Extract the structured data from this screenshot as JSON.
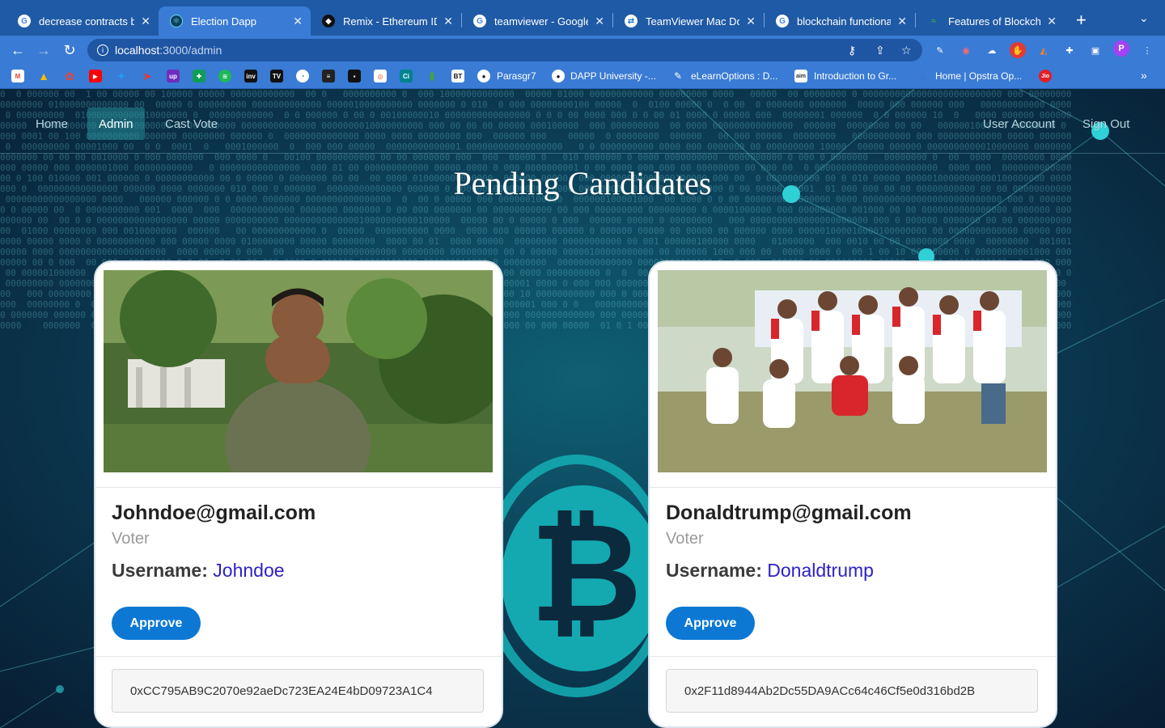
{
  "browser": {
    "tabs": [
      {
        "title": "decrease contracts b",
        "icon": "google-icon"
      },
      {
        "title": "Election Dapp",
        "icon": "react-icon",
        "active": true
      },
      {
        "title": "Remix - Ethereum IDE",
        "icon": "remix-icon"
      },
      {
        "title": "teamviewer - Google",
        "icon": "google-icon"
      },
      {
        "title": "TeamViewer Mac Dow",
        "icon": "teamviewer-icon"
      },
      {
        "title": "blockchain functional",
        "icon": "google-icon"
      },
      {
        "title": "Features of Blockchai",
        "icon": "site-icon"
      }
    ],
    "url_host": "localhost",
    "url_path": ":3000/admin",
    "profile_initial": "P",
    "bookmarks": [
      {
        "label": "Parasgr7",
        "icon": "github-icon"
      },
      {
        "label": "DAPP University -...",
        "icon": "github-icon"
      },
      {
        "label": "eLearnOptions : D...",
        "icon": "elearn-icon"
      },
      {
        "label": "Introduction to Gr...",
        "icon": "aim-icon"
      },
      {
        "label": "Home | Opstra Op...",
        "icon": "opstra-icon"
      }
    ],
    "bookmark_icon_labels": [
      "inv",
      "TV",
      "BT",
      "Ci",
      "up"
    ]
  },
  "nav": {
    "home": "Home",
    "admin": "Admin",
    "cast_vote": "Cast Vote",
    "user_account": "User Account",
    "sign_out": "Sign Out"
  },
  "page_title": "Pending Candidates",
  "labels": {
    "username_prefix": "Username: ",
    "approve": "Approve"
  },
  "candidates": [
    {
      "email": "Johndoe@gmail.com",
      "role": "Voter",
      "username": "Johndoe",
      "address": "0xCC795AB9C2070e92aeDc723EA24E4bD09723A1C4"
    },
    {
      "email": "Donaldtrump@gmail.com",
      "role": "Voter",
      "username": "Donaldtrump",
      "address": "0x2F11d8944Ab2Dc55DA9ACc64c46Cf5e0d316bd2B"
    }
  ],
  "colors": {
    "accent_button": "#0c78d4",
    "username_value": "#2b1fc9",
    "browser_chrome": "#3a7bd5",
    "bitcoin_teal": "#13a8b0"
  }
}
